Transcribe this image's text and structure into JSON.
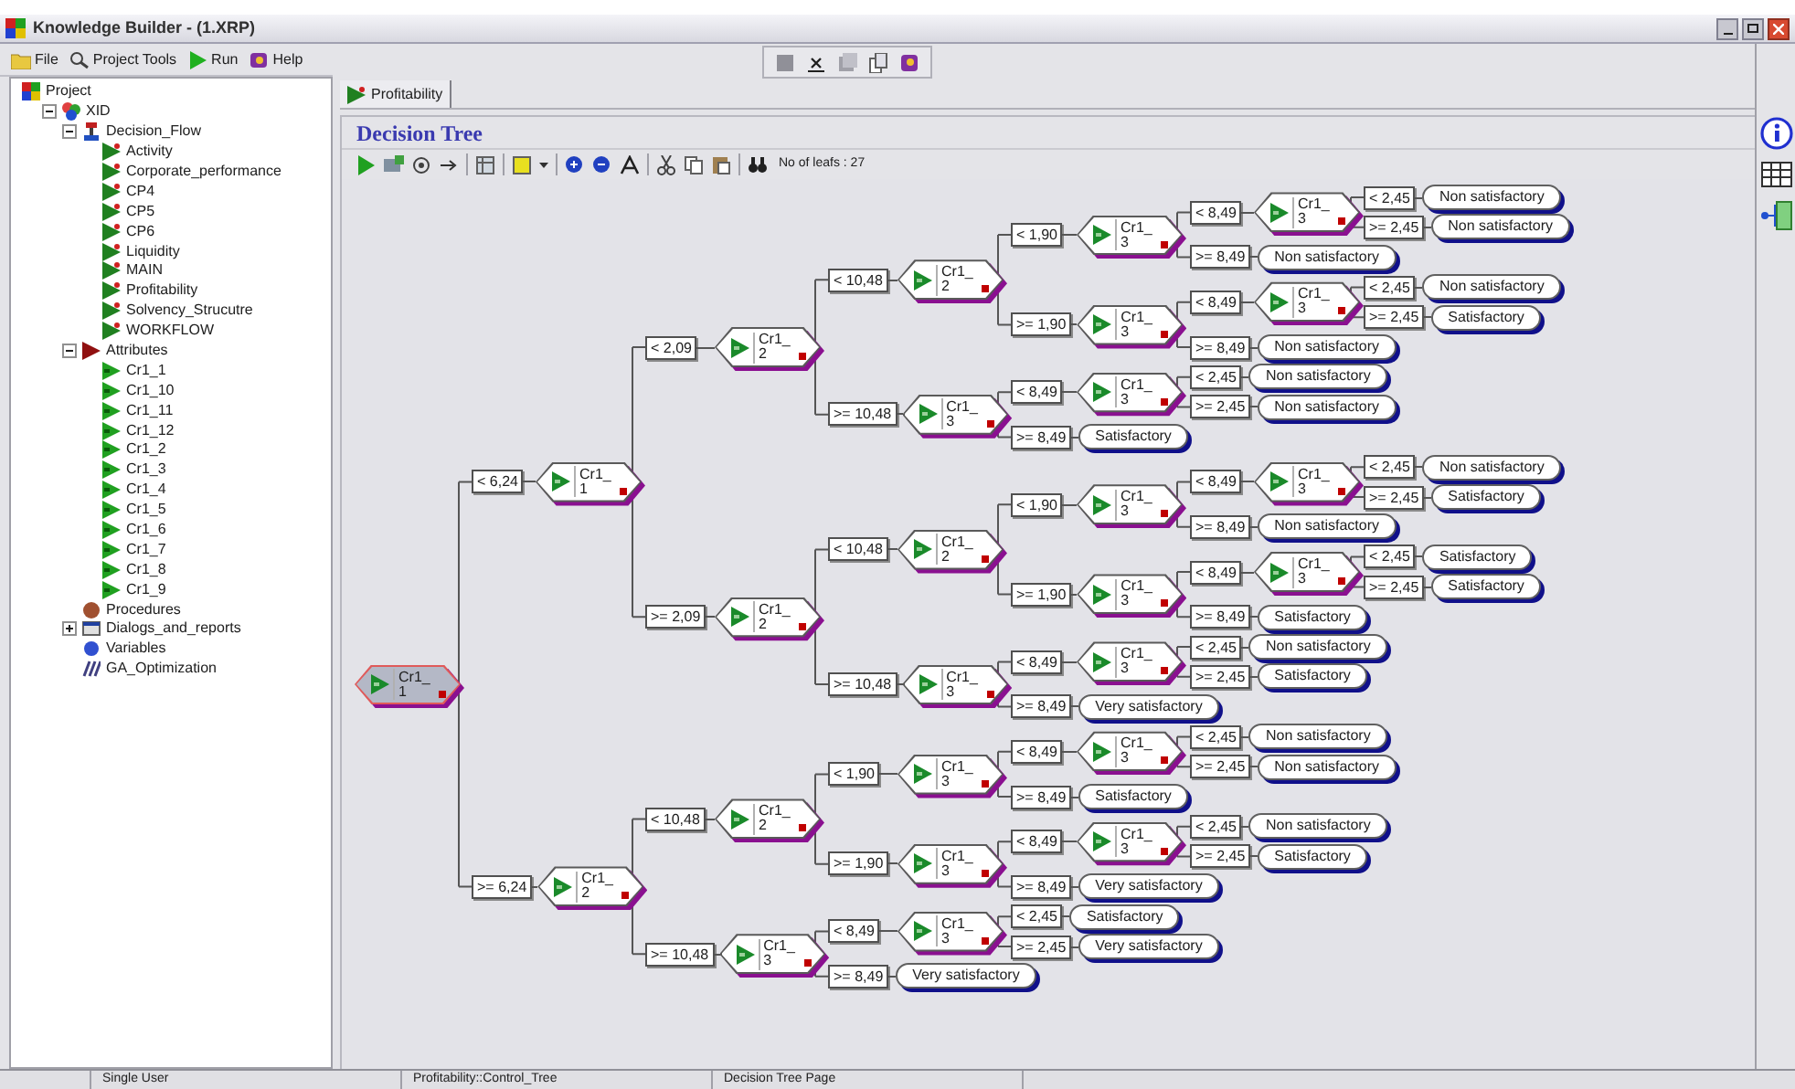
{
  "window": {
    "title": "Knowledge Builder - (1.XRP)"
  },
  "menu": [
    {
      "label": "File",
      "kind": "folder"
    },
    {
      "label": "Project Tools",
      "kind": "tools"
    },
    {
      "label": "Run",
      "kind": "run"
    },
    {
      "label": "Help",
      "kind": "help"
    }
  ],
  "project_tree": {
    "label": "Project",
    "kind": "project",
    "children": [
      {
        "label": "XID",
        "kind": "xid",
        "expanded": true,
        "children": [
          {
            "label": "Decision_Flow",
            "kind": "flow",
            "expanded": true,
            "children": [
              {
                "label": "Activity",
                "kind": "rule"
              },
              {
                "label": "Corporate_performance",
                "kind": "rule"
              },
              {
                "label": "CP4",
                "kind": "rule"
              },
              {
                "label": "CP5",
                "kind": "rule"
              },
              {
                "label": "CP6",
                "kind": "rule"
              },
              {
                "label": "Liquidity",
                "kind": "rule"
              },
              {
                "label": "MAIN",
                "kind": "rule"
              },
              {
                "label": "Profitability",
                "kind": "rule"
              },
              {
                "label": "Solvency_Strucutre",
                "kind": "rule"
              },
              {
                "label": "WORKFLOW",
                "kind": "rule"
              }
            ]
          },
          {
            "label": "Attributes",
            "kind": "attributes",
            "expanded": true,
            "children": [
              {
                "label": "Cr1_1",
                "kind": "attribute"
              },
              {
                "label": "Cr1_10",
                "kind": "attribute"
              },
              {
                "label": "Cr1_11",
                "kind": "attribute"
              },
              {
                "label": "Cr1_12",
                "kind": "attribute"
              },
              {
                "label": "Cr1_2",
                "kind": "attribute"
              },
              {
                "label": "Cr1_3",
                "kind": "attribute"
              },
              {
                "label": "Cr1_4",
                "kind": "attribute"
              },
              {
                "label": "Cr1_5",
                "kind": "attribute"
              },
              {
                "label": "Cr1_6",
                "kind": "attribute"
              },
              {
                "label": "Cr1_7",
                "kind": "attribute"
              },
              {
                "label": "Cr1_8",
                "kind": "attribute"
              },
              {
                "label": "Cr1_9",
                "kind": "attribute"
              }
            ]
          },
          {
            "label": "Procedures",
            "kind": "procedures"
          },
          {
            "label": "Dialogs_and_reports",
            "kind": "dialogs",
            "expanded": false
          },
          {
            "label": "Variables",
            "kind": "variables"
          },
          {
            "label": "GA_Optimization",
            "kind": "ga"
          }
        ]
      }
    ]
  },
  "tabs": [
    {
      "label": "Profitability",
      "selected": true
    }
  ],
  "decision_tree": {
    "title": "Decision Tree",
    "leaf_count": "No of leafs : 27",
    "root": {
      "kind": "decision",
      "attr": "Cr1_",
      "num": "1",
      "selected": true,
      "children": [
        {
          "edge": "< 6,24",
          "kind": "decision",
          "attr": "Cr1_",
          "num": "1",
          "selected": false,
          "children": [
            {
              "edge": "< 2,09",
              "kind": "decision",
              "attr": "Cr1_",
              "num": "2",
              "selected": false,
              "children": [
                {
                  "edge": "< 10,48",
                  "kind": "decision",
                  "attr": "Cr1_",
                  "num": "2",
                  "selected": false,
                  "children": [
                    {
                      "edge": "< 1,90",
                      "kind": "decision",
                      "attr": "Cr1_",
                      "num": "3",
                      "selected": false,
                      "children": [
                        {
                          "edge": "< 8,49",
                          "kind": "decision",
                          "attr": "Cr1_",
                          "num": "3",
                          "selected": false,
                          "children": [
                            {
                              "edge": "< 2,45",
                              "kind": "leaf",
                              "label": "Non satisfactory"
                            },
                            {
                              "edge": ">= 2,45",
                              "kind": "leaf",
                              "label": "Non satisfactory"
                            }
                          ]
                        },
                        {
                          "edge": ">= 8,49",
                          "kind": "leaf",
                          "label": "Non satisfactory"
                        }
                      ]
                    },
                    {
                      "edge": ">= 1,90",
                      "kind": "decision",
                      "attr": "Cr1_",
                      "num": "3",
                      "selected": false,
                      "children": [
                        {
                          "edge": "< 8,49",
                          "kind": "decision",
                          "attr": "Cr1_",
                          "num": "3",
                          "selected": false,
                          "children": [
                            {
                              "edge": "< 2,45",
                              "kind": "leaf",
                              "label": "Non satisfactory"
                            },
                            {
                              "edge": ">= 2,45",
                              "kind": "leaf",
                              "label": "Satisfactory"
                            }
                          ]
                        },
                        {
                          "edge": ">= 8,49",
                          "kind": "leaf",
                          "label": "Non satisfactory"
                        }
                      ]
                    }
                  ]
                },
                {
                  "edge": ">= 10,48",
                  "kind": "decision",
                  "attr": "Cr1_",
                  "num": "3",
                  "selected": false,
                  "children": [
                    {
                      "edge": "< 8,49",
                      "kind": "decision",
                      "attr": "Cr1_",
                      "num": "3",
                      "selected": false,
                      "children": [
                        {
                          "edge": "< 2,45",
                          "kind": "leaf",
                          "label": "Non satisfactory"
                        },
                        {
                          "edge": ">= 2,45",
                          "kind": "leaf",
                          "label": "Non satisfactory"
                        }
                      ]
                    },
                    {
                      "edge": ">= 8,49",
                      "kind": "leaf",
                      "label": "Satisfactory"
                    }
                  ]
                }
              ]
            },
            {
              "edge": ">= 2,09",
              "kind": "decision",
              "attr": "Cr1_",
              "num": "2",
              "selected": false,
              "children": [
                {
                  "edge": "< 10,48",
                  "kind": "decision",
                  "attr": "Cr1_",
                  "num": "2",
                  "selected": false,
                  "children": [
                    {
                      "edge": "< 1,90",
                      "kind": "decision",
                      "attr": "Cr1_",
                      "num": "3",
                      "selected": false,
                      "children": [
                        {
                          "edge": "< 8,49",
                          "kind": "decision",
                          "attr": "Cr1_",
                          "num": "3",
                          "selected": false,
                          "children": [
                            {
                              "edge": "< 2,45",
                              "kind": "leaf",
                              "label": "Non satisfactory"
                            },
                            {
                              "edge": ">= 2,45",
                              "kind": "leaf",
                              "label": "Satisfactory"
                            }
                          ]
                        },
                        {
                          "edge": ">= 8,49",
                          "kind": "leaf",
                          "label": "Non satisfactory"
                        }
                      ]
                    },
                    {
                      "edge": ">= 1,90",
                      "kind": "decision",
                      "attr": "Cr1_",
                      "num": "3",
                      "selected": false,
                      "children": [
                        {
                          "edge": "< 8,49",
                          "kind": "decision",
                          "attr": "Cr1_",
                          "num": "3",
                          "selected": false,
                          "children": [
                            {
                              "edge": "< 2,45",
                              "kind": "leaf",
                              "label": "Satisfactory"
                            },
                            {
                              "edge": ">= 2,45",
                              "kind": "leaf",
                              "label": "Satisfactory"
                            }
                          ]
                        },
                        {
                          "edge": ">= 8,49",
                          "kind": "leaf",
                          "label": "Satisfactory"
                        }
                      ]
                    }
                  ]
                },
                {
                  "edge": ">= 10,48",
                  "kind": "decision",
                  "attr": "Cr1_",
                  "num": "3",
                  "selected": false,
                  "children": [
                    {
                      "edge": "< 8,49",
                      "kind": "decision",
                      "attr": "Cr1_",
                      "num": "3",
                      "selected": false,
                      "children": [
                        {
                          "edge": "< 2,45",
                          "kind": "leaf",
                          "label": "Non satisfactory"
                        },
                        {
                          "edge": ">= 2,45",
                          "kind": "leaf",
                          "label": "Satisfactory"
                        }
                      ]
                    },
                    {
                      "edge": ">= 8,49",
                      "kind": "leaf",
                      "label": "Very satisfactory"
                    }
                  ]
                }
              ]
            }
          ]
        },
        {
          "edge": ">= 6,24",
          "kind": "decision",
          "attr": "Cr1_",
          "num": "2",
          "selected": false,
          "children": [
            {
              "edge": "< 10,48",
              "kind": "decision",
              "attr": "Cr1_",
              "num": "2",
              "selected": false,
              "children": [
                {
                  "edge": "< 1,90",
                  "kind": "decision",
                  "attr": "Cr1_",
                  "num": "3",
                  "selected": false,
                  "children": [
                    {
                      "edge": "< 8,49",
                      "kind": "decision",
                      "attr": "Cr1_",
                      "num": "3",
                      "selected": false,
                      "children": [
                        {
                          "edge": "< 2,45",
                          "kind": "leaf",
                          "label": "Non satisfactory"
                        },
                        {
                          "edge": ">= 2,45",
                          "kind": "leaf",
                          "label": "Non satisfactory"
                        }
                      ]
                    },
                    {
                      "edge": ">= 8,49",
                      "kind": "leaf",
                      "label": "Satisfactory"
                    }
                  ]
                },
                {
                  "edge": ">= 1,90",
                  "kind": "decision",
                  "attr": "Cr1_",
                  "num": "3",
                  "selected": false,
                  "children": [
                    {
                      "edge": "< 8,49",
                      "kind": "decision",
                      "attr": "Cr1_",
                      "num": "3",
                      "selected": false,
                      "children": [
                        {
                          "edge": "< 2,45",
                          "kind": "leaf",
                          "label": "Non satisfactory"
                        },
                        {
                          "edge": ">= 2,45",
                          "kind": "leaf",
                          "label": "Satisfactory"
                        }
                      ]
                    },
                    {
                      "edge": ">= 8,49",
                      "kind": "leaf",
                      "label": "Very satisfactory"
                    }
                  ]
                }
              ]
            },
            {
              "edge": ">= 10,48",
              "kind": "decision",
              "attr": "Cr1_",
              "num": "3",
              "selected": false,
              "children": [
                {
                  "edge": "< 8,49",
                  "kind": "decision",
                  "attr": "Cr1_",
                  "num": "3",
                  "selected": false,
                  "children": [
                    {
                      "edge": "< 2,45",
                      "kind": "leaf",
                      "label": "Satisfactory"
                    },
                    {
                      "edge": ">= 2,45",
                      "kind": "leaf",
                      "label": "Very satisfactory"
                    }
                  ]
                },
                {
                  "edge": ">= 8,49",
                  "kind": "leaf",
                  "label": "Very satisfactory"
                }
              ]
            }
          ]
        }
      ]
    }
  },
  "status_bar": [
    "Single User",
    "Profitability::Control_Tree",
    "Decision Tree Page"
  ]
}
